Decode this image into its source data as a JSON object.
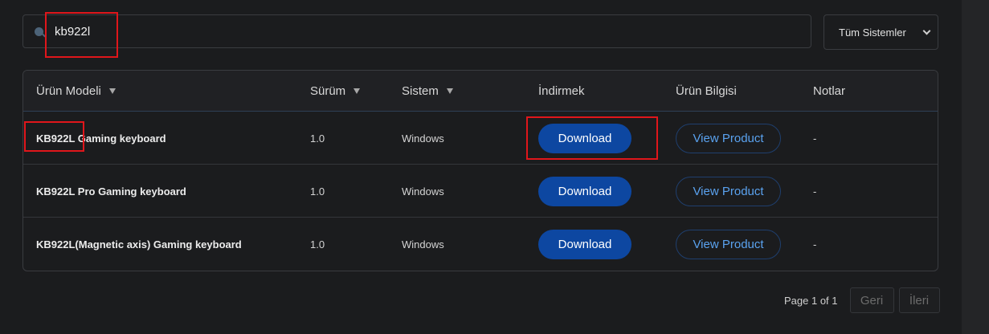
{
  "search": {
    "value": "kb922l"
  },
  "system_filter": {
    "selected": "Tüm Sistemler"
  },
  "table": {
    "headers": {
      "model": "Ürün Modeli",
      "version": "Sürüm",
      "system": "Sistem",
      "download": "İndirmek",
      "product_info": "Ürün Bilgisi",
      "notes": "Notlar"
    },
    "rows": [
      {
        "model": "KB922L Gaming keyboard",
        "version": "1.0",
        "system": "Windows",
        "download": "Download",
        "view": "View Product",
        "notes": "-"
      },
      {
        "model": "KB922L Pro Gaming keyboard",
        "version": "1.0",
        "system": "Windows",
        "download": "Download",
        "view": "View Product",
        "notes": "-"
      },
      {
        "model": "KB922L(Magnetic axis) Gaming keyboard",
        "version": "1.0",
        "system": "Windows",
        "download": "Download",
        "view": "View Product",
        "notes": "-"
      }
    ]
  },
  "pagination": {
    "page_text": "Page 1 of 1",
    "prev": "Geri",
    "next": "İleri"
  },
  "colors": {
    "accent": "#0d47a1",
    "highlight": "#e0161b",
    "link": "#5aa2ef"
  }
}
